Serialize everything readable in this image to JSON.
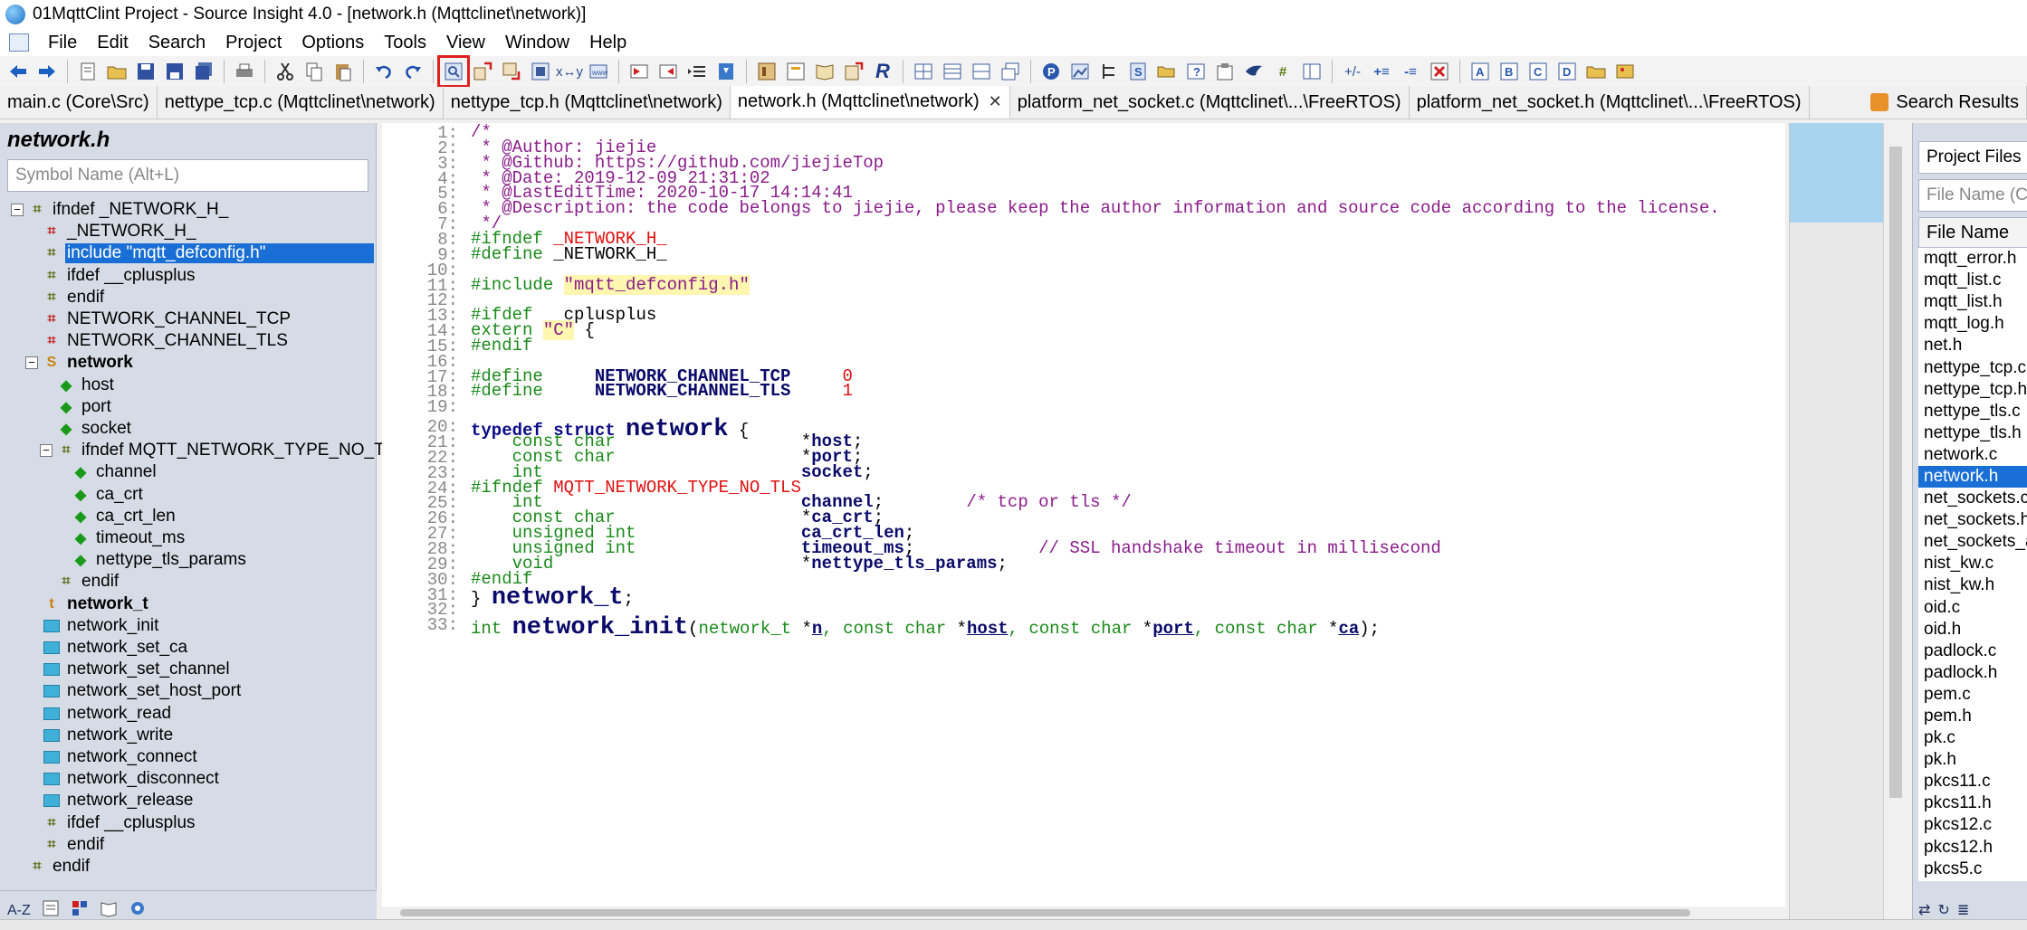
{
  "window": {
    "title": "01MqttClint Project - Source Insight 4.0 - [network.h (Mqttclinet\\network)]"
  },
  "menu": [
    "File",
    "Edit",
    "Search",
    "Project",
    "Options",
    "Tools",
    "View",
    "Window",
    "Help"
  ],
  "tabs": [
    {
      "label": "main.c (Core\\Src)",
      "active": false
    },
    {
      "label": "nettype_tcp.c (Mqttclinet\\network)",
      "active": false
    },
    {
      "label": "nettype_tcp.h (Mqttclinet\\network)",
      "active": false
    },
    {
      "label": "network.h (Mqttclinet\\network)",
      "active": true,
      "close": "✕"
    },
    {
      "label": "platform_net_socket.c (Mqttclinet\\...\\FreeRTOS)",
      "active": false
    },
    {
      "label": "platform_net_socket.h (Mqttclinet\\...\\FreeRTOS)",
      "active": false
    }
  ],
  "search_results_tab": "Search Results",
  "symbol_panel": {
    "title": "network.h",
    "search_placeholder": "Symbol Name (Alt+L)",
    "items": [
      {
        "label": "ifndef _NETWORK_H_",
        "icon": "grid",
        "depth": 0,
        "expander": "⊟"
      },
      {
        "label": "_NETWORK_H_",
        "icon": "grid-red",
        "depth": 1
      },
      {
        "label": "include \"mqtt_defconfig.h\"",
        "icon": "grid",
        "depth": 1,
        "selected": true
      },
      {
        "label": "ifdef __cplusplus",
        "icon": "grid",
        "depth": 1
      },
      {
        "label": "endif",
        "icon": "grid",
        "depth": 1
      },
      {
        "label": "NETWORK_CHANNEL_TCP",
        "icon": "grid-red",
        "depth": 1
      },
      {
        "label": "NETWORK_CHANNEL_TLS",
        "icon": "grid-red",
        "depth": 1
      },
      {
        "label": "network",
        "icon": "struct",
        "depth": 1,
        "bold": true,
        "expander": "⊟"
      },
      {
        "label": "host",
        "icon": "member",
        "depth": 2
      },
      {
        "label": "port",
        "icon": "member",
        "depth": 2
      },
      {
        "label": "socket",
        "icon": "member",
        "depth": 2
      },
      {
        "label": "ifndef MQTT_NETWORK_TYPE_NO_T",
        "icon": "grid",
        "depth": 2,
        "expander": "⊟"
      },
      {
        "label": "channel",
        "icon": "member",
        "depth": 3
      },
      {
        "label": "ca_crt",
        "icon": "member",
        "depth": 3
      },
      {
        "label": "ca_crt_len",
        "icon": "member",
        "depth": 3
      },
      {
        "label": "timeout_ms",
        "icon": "member",
        "depth": 3
      },
      {
        "label": "nettype_tls_params",
        "icon": "member",
        "depth": 3
      },
      {
        "label": "endif",
        "icon": "grid",
        "depth": 2
      },
      {
        "label": "network_t",
        "icon": "typedef",
        "depth": 1,
        "bold": true
      },
      {
        "label": "network_init",
        "icon": "function",
        "depth": 1
      },
      {
        "label": "network_set_ca",
        "icon": "function",
        "depth": 1
      },
      {
        "label": "network_set_channel",
        "icon": "function",
        "depth": 1
      },
      {
        "label": "network_set_host_port",
        "icon": "function",
        "depth": 1
      },
      {
        "label": "network_read",
        "icon": "function",
        "depth": 1
      },
      {
        "label": "network_write",
        "icon": "function",
        "depth": 1
      },
      {
        "label": "network_connect",
        "icon": "function",
        "depth": 1
      },
      {
        "label": "network_disconnect",
        "icon": "function",
        "depth": 1
      },
      {
        "label": "network_release",
        "icon": "function",
        "depth": 1
      },
      {
        "label": "ifdef __cplusplus",
        "icon": "grid",
        "depth": 1
      },
      {
        "label": "endif",
        "icon": "grid",
        "depth": 1
      },
      {
        "label": "endif",
        "icon": "grid",
        "depth": 0
      }
    ],
    "bottom_az": "A-Z"
  },
  "editor": {
    "lines": [
      {
        "n": "1:",
        "segs": [
          [
            "cm",
            "/*"
          ]
        ]
      },
      {
        "n": "2:",
        "segs": [
          [
            "cm",
            " * @Author: jiejie"
          ]
        ]
      },
      {
        "n": "3:",
        "segs": [
          [
            "cm",
            " * @Github: https://github.com/jiejieTop"
          ]
        ]
      },
      {
        "n": "4:",
        "segs": [
          [
            "cm",
            " * @Date: 2019-12-09 21:31:02"
          ]
        ]
      },
      {
        "n": "5:",
        "segs": [
          [
            "cm",
            " * @LastEditTime: 2020-10-17 14:14:41"
          ]
        ]
      },
      {
        "n": "6:",
        "segs": [
          [
            "cm",
            " * @Description: the code belongs to jiejie, please keep the author information and source code according to the license."
          ]
        ]
      },
      {
        "n": "7:",
        "segs": [
          [
            "cm",
            " */"
          ]
        ]
      },
      {
        "n": "8:",
        "segs": [
          [
            "pp",
            "#ifndef "
          ],
          [
            "mac",
            "_NETWORK_H_"
          ]
        ]
      },
      {
        "n": "9:",
        "segs": [
          [
            "pp",
            "#define "
          ],
          [
            "pl",
            "_NETWORK_H_"
          ]
        ]
      },
      {
        "n": "10:",
        "segs": []
      },
      {
        "n": "11:",
        "segs": [
          [
            "pp",
            "#include "
          ],
          [
            "str",
            "\"mqtt_defconfig.h\""
          ]
        ]
      },
      {
        "n": "12:",
        "segs": []
      },
      {
        "n": "13:",
        "segs": [
          [
            "pp",
            "#ifdef "
          ],
          [
            "pl",
            "__cplusplus"
          ]
        ]
      },
      {
        "n": "14:",
        "segs": [
          [
            "pp",
            "extern "
          ],
          [
            "str",
            "\"C\""
          ],
          [
            "pl",
            " {"
          ]
        ]
      },
      {
        "n": "15:",
        "segs": [
          [
            "pp",
            "#endif"
          ]
        ]
      },
      {
        "n": "16:",
        "segs": []
      },
      {
        "n": "17:",
        "segs": [
          [
            "pp",
            "#define     "
          ],
          [
            "mem",
            "NETWORK_CHANNEL_TCP"
          ],
          [
            "pl",
            "     "
          ],
          [
            "num",
            "0"
          ]
        ]
      },
      {
        "n": "18:",
        "segs": [
          [
            "pp",
            "#define     "
          ],
          [
            "mem",
            "NETWORK_CHANNEL_TLS"
          ],
          [
            "pl",
            "     "
          ],
          [
            "num",
            "1"
          ]
        ]
      },
      {
        "n": "19:",
        "segs": []
      },
      {
        "n": "20:",
        "segs": [
          [
            "kw",
            "typedef struct "
          ],
          [
            "big",
            "network"
          ],
          [
            "pl",
            " {"
          ]
        ]
      },
      {
        "n": "21:",
        "segs": [
          [
            "ty",
            "    const char                  "
          ],
          [
            "pl",
            "*"
          ],
          [
            "mem",
            "host"
          ],
          [
            "pl",
            ";"
          ]
        ]
      },
      {
        "n": "22:",
        "segs": [
          [
            "ty",
            "    const char                  "
          ],
          [
            "pl",
            "*"
          ],
          [
            "mem",
            "port"
          ],
          [
            "pl",
            ";"
          ]
        ]
      },
      {
        "n": "23:",
        "segs": [
          [
            "ty",
            "    int                         "
          ],
          [
            "mem",
            "socket"
          ],
          [
            "pl",
            ";"
          ]
        ]
      },
      {
        "n": "24:",
        "segs": [
          [
            "pp",
            "#ifndef "
          ],
          [
            "mac",
            "MQTT_NETWORK_TYPE_NO_TLS"
          ]
        ]
      },
      {
        "n": "25:",
        "segs": [
          [
            "ty",
            "    int                         "
          ],
          [
            "mem",
            "channel"
          ],
          [
            "pl",
            ";        "
          ],
          [
            "cm",
            "/* tcp or tls */"
          ]
        ]
      },
      {
        "n": "26:",
        "segs": [
          [
            "ty",
            "    const char                  "
          ],
          [
            "pl",
            "*"
          ],
          [
            "mem",
            "ca_crt"
          ],
          [
            "pl",
            ";"
          ]
        ]
      },
      {
        "n": "27:",
        "segs": [
          [
            "ty",
            "    unsigned int                "
          ],
          [
            "mem",
            "ca_crt_len"
          ],
          [
            "pl",
            ";"
          ]
        ]
      },
      {
        "n": "28:",
        "segs": [
          [
            "ty",
            "    unsigned int                "
          ],
          [
            "mem",
            "timeout_ms"
          ],
          [
            "pl",
            ";            "
          ],
          [
            "cm",
            "// SSL handshake timeout in millisecond"
          ]
        ]
      },
      {
        "n": "29:",
        "segs": [
          [
            "ty",
            "    void                        "
          ],
          [
            "pl",
            "*"
          ],
          [
            "mem",
            "nettype_tls_params"
          ],
          [
            "pl",
            ";"
          ]
        ]
      },
      {
        "n": "30:",
        "segs": [
          [
            "pp",
            "#endif"
          ]
        ]
      },
      {
        "n": "31:",
        "segs": [
          [
            "pl",
            "} "
          ],
          [
            "big",
            "network_t"
          ],
          [
            "pl",
            ";"
          ]
        ]
      },
      {
        "n": "32:",
        "segs": []
      },
      {
        "n": "33:",
        "segs": [
          [
            "ty",
            "int "
          ],
          [
            "big",
            "network_init"
          ],
          [
            "pl",
            "("
          ],
          [
            "ty",
            "network_t "
          ],
          [
            "pl",
            "*"
          ],
          [
            "ul",
            "n"
          ],
          [
            "ty",
            ", const char "
          ],
          [
            "pl",
            "*"
          ],
          [
            "ul",
            "host"
          ],
          [
            "ty",
            ", const char "
          ],
          [
            "pl",
            "*"
          ],
          [
            "ul",
            "port"
          ],
          [
            "ty",
            ", const char "
          ],
          [
            "pl",
            "*"
          ],
          [
            "ul",
            "ca"
          ],
          [
            "pl",
            ");"
          ]
        ]
      }
    ]
  },
  "project_panel": {
    "title": "Project Files",
    "search_placeholder": "File Name (Ct",
    "column_header": "File Name",
    "files": [
      "mqtt_error.h",
      "mqtt_list.c",
      "mqtt_list.h",
      "mqtt_log.h",
      "net.h",
      "nettype_tcp.c",
      "nettype_tcp.h",
      "nettype_tls.c",
      "nettype_tls.h",
      "network.c",
      "network.h",
      "net_sockets.c",
      "net_sockets.h",
      "net_sockets_a",
      "nist_kw.c",
      "nist_kw.h",
      "oid.c",
      "oid.h",
      "padlock.c",
      "padlock.h",
      "pem.c",
      "pem.h",
      "pk.c",
      "pk.h",
      "pkcs11.c",
      "pkcs11.h",
      "pkcs12.c",
      "pkcs12.h",
      "pkcs5.c"
    ],
    "selected_file": "network.h"
  },
  "colors": {
    "selection": "#1a6fd6",
    "highlight_box": "#e02020",
    "comment": "#8a1c8a",
    "preprocessor": "#1a8a1a",
    "macro": "#e01010"
  }
}
